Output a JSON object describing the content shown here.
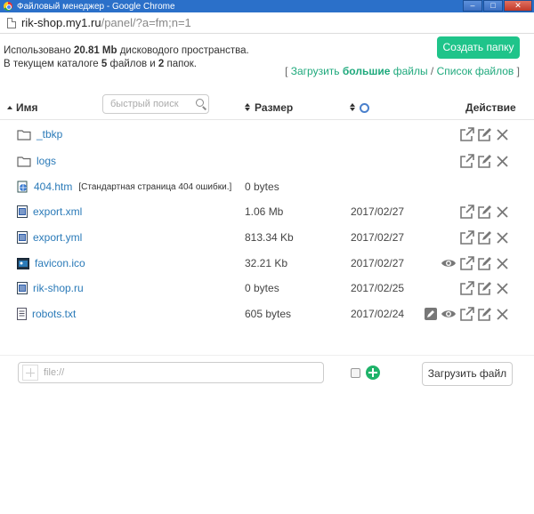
{
  "window": {
    "title": "Файловый менеджер - Google Chrome"
  },
  "address": {
    "host": "rik-shop.my1.ru",
    "path": "/panel/?a=fm;n=1"
  },
  "info": {
    "line1_pre": "Использовано ",
    "used": "20.81 Mb",
    "line1_post": " дисководого пространства.",
    "line2_pre": "В текущем каталоге ",
    "files": "5",
    "line2_mid1": " файлов и ",
    "folders": "2",
    "line2_mid2": " папок."
  },
  "toolbar": {
    "create_folder": "Создать папку",
    "bracket_open": "[",
    "upload_pre": "Загрузить ",
    "upload_big": "большие",
    "upload_post": " файлы",
    "slash": " / ",
    "file_list": "Список файлов",
    "bracket_close": "]"
  },
  "table": {
    "col_name": "Имя",
    "search_placeholder": "быстрый поиск",
    "col_size": "Размер",
    "col_action": "Действие"
  },
  "rows": [
    {
      "type": "folder",
      "name": "_tbkp",
      "desc": "",
      "size": "",
      "date": ""
    },
    {
      "type": "folder",
      "name": "logs",
      "desc": "",
      "size": "",
      "date": ""
    },
    {
      "type": "html",
      "name": "404.htm",
      "desc": "[Стандартная страница 404 ошибки.]",
      "size": "0 bytes",
      "date": ""
    },
    {
      "type": "doc",
      "name": "export.xml",
      "desc": "",
      "size": "1.06 Mb",
      "date": "2017/02/27"
    },
    {
      "type": "doc",
      "name": "export.yml",
      "desc": "",
      "size": "813.34 Kb",
      "date": "2017/02/27"
    },
    {
      "type": "image",
      "name": "favicon.ico",
      "desc": "",
      "size": "32.21 Kb",
      "date": "2017/02/27"
    },
    {
      "type": "doc",
      "name": "rik-shop.ru",
      "desc": "",
      "size": "0 bytes",
      "date": "2017/02/25"
    },
    {
      "type": "text",
      "name": "robots.txt",
      "desc": "",
      "size": "605 bytes",
      "date": "2017/02/24"
    }
  ],
  "upload": {
    "file_placeholder": "file://",
    "upload_button": "Загрузить файл"
  },
  "colors": {
    "accent": "#1fc48a",
    "link": "#2a7ab8",
    "titlebar": "#2b70c9"
  }
}
